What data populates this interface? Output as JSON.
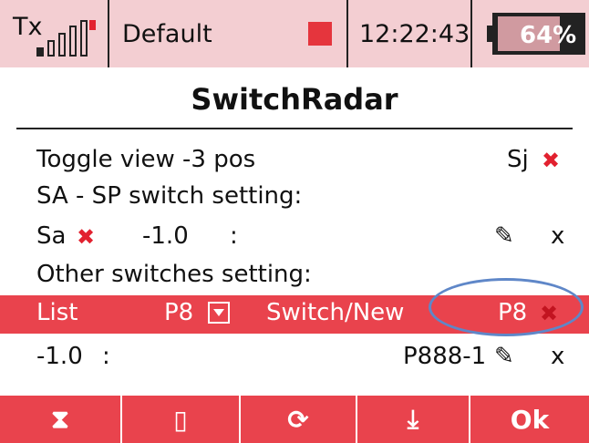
{
  "status_bar": {
    "tx_label": "Tx",
    "model_name": "Default",
    "time": "12:22:43",
    "battery_percent": "64%"
  },
  "title": "SwitchRadar",
  "rows": {
    "toggle_view": {
      "label": "Toggle view -3 pos",
      "switch": "Sj",
      "mark": "✖"
    },
    "sa_sp_header": {
      "label": "SA - SP switch setting:"
    },
    "sa_row": {
      "switch": "Sa",
      "mark": "✖",
      "value": "-1.0",
      "colon": ":",
      "edit_icon": "✎",
      "delete": "x"
    },
    "other_header": {
      "label": "Other switches setting:"
    },
    "list_row": {
      "list_label": "List",
      "list_value": "P8",
      "switch_new_label": "Switch/New",
      "switch_value": "P8",
      "mark": "✖"
    },
    "p888_row": {
      "value": "-1.0",
      "colon": ":",
      "switch": "P888-1",
      "edit_icon": "✎",
      "delete": "x"
    }
  },
  "buttons": {
    "timer_icon": "⧗",
    "page_icon": "▯",
    "refresh_icon": "⟳",
    "download_icon": "⤓",
    "ok": "Ok"
  },
  "colors": {
    "accent": "#e9434d",
    "header_bg": "#f3ced2",
    "highlight_ellipse": "#5f87c8"
  }
}
